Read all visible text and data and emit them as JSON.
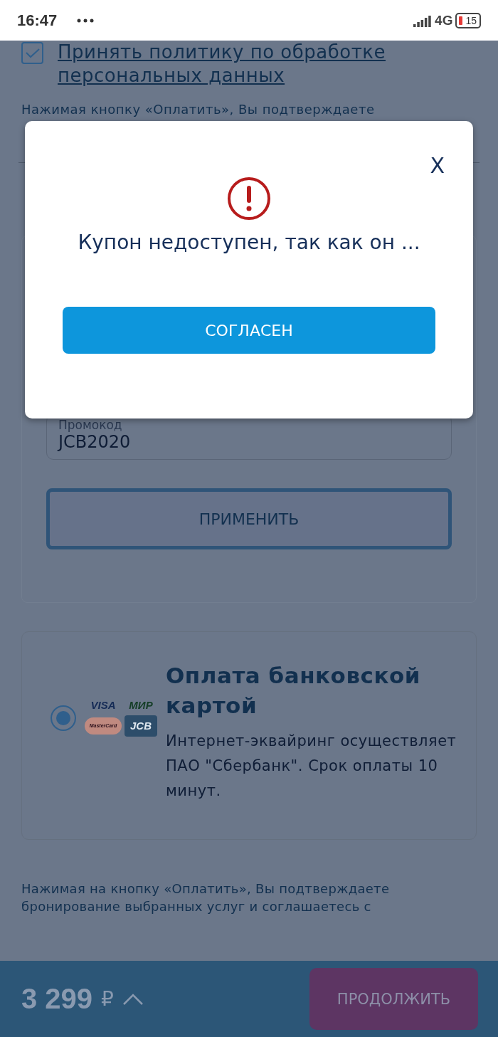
{
  "status_bar": {
    "time": "16:47",
    "network": "4G",
    "battery": "15"
  },
  "consent": {
    "checked": true,
    "link": "Принять политику по обработке персональных данных"
  },
  "consent_note": "Нажимая кнопку «Оплатить», Вы подтверждаете",
  "promo": {
    "label": "Промокод",
    "value": "JCB2020",
    "apply_button": "ПРИМЕНИТЬ"
  },
  "payment_method": {
    "selected": true,
    "title": "Оплата банковской картой",
    "card_logos": [
      {
        "kind": "visa",
        "text": "VISA"
      },
      {
        "kind": "mir",
        "text": "МИР"
      },
      {
        "kind": "mastercard",
        "text": "MasterCard"
      },
      {
        "kind": "jcb",
        "text": "JCB"
      }
    ],
    "description": "Интернет-эквайринг осуществляет ПАО \"Сбербанк\". Срок оплаты 10 минут."
  },
  "disclaimer": "Нажимая на кнопку «Оплатить», Вы подтверждаете бронирование выбранных услуг и соглашаетесь с",
  "bottom_bar": {
    "price": "3 299",
    "currency": "₽",
    "continue_button": "ПРОДОЛЖИТЬ"
  },
  "dialog": {
    "close": "X",
    "message": "Купон недоступен, так как он ...",
    "button": "СОГЛАСЕН"
  }
}
